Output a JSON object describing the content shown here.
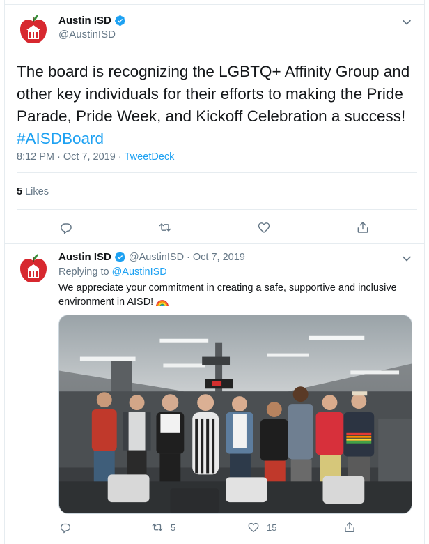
{
  "main_tweet": {
    "author_name": "Austin ISD",
    "handle": "@AustinISD",
    "text": "The board is recognizing the LGBTQ+ Affinity Group and other key individuals for their efforts to making the Pride Parade, Pride Week, and Kickoff Celebration a success! ",
    "hashtag": "#AISDBoard",
    "time": "8:12 PM",
    "separator": "·",
    "date": "Oct 7, 2019",
    "source": "TweetDeck",
    "likes_count": "5",
    "likes_label": "Likes"
  },
  "reply_tweet": {
    "author_name": "Austin ISD",
    "handle": "@AustinISD",
    "separator": "·",
    "date": "Oct 7, 2019",
    "replying_label": "Replying to",
    "replying_to": "@AustinISD",
    "text": "We appreciate your commitment in creating a safe, supportive and inclusive environment in AISD! ",
    "retweet_count": "5",
    "like_count": "15"
  },
  "colors": {
    "accent": "#1da1f2",
    "secondary_text": "#657786",
    "avatar_red": "#d7282f"
  },
  "icons": [
    "verified-badge",
    "chevron-down-icon",
    "reply-icon",
    "retweet-icon",
    "like-icon",
    "share-icon",
    "rainbow-emoji"
  ]
}
